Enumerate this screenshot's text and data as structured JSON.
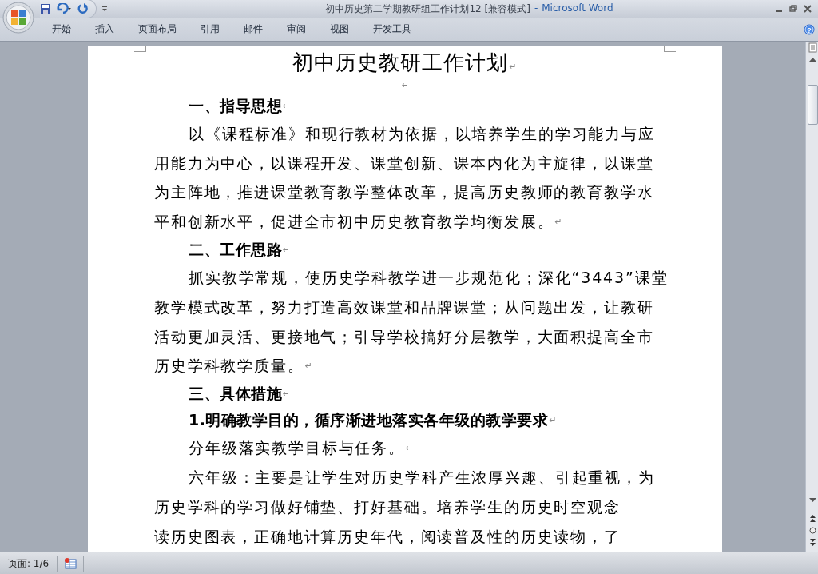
{
  "window": {
    "title": "初中历史第二学期教研组工作计划12 [兼容模式]",
    "separator": "-",
    "app_name": "Microsoft Word"
  },
  "ribbon": {
    "help_label": "?",
    "tabs": [
      {
        "label": "开始",
        "selected": false
      },
      {
        "label": "插入",
        "selected": false
      },
      {
        "label": "页面布局",
        "selected": false
      },
      {
        "label": "引用",
        "selected": false
      },
      {
        "label": "邮件",
        "selected": false
      },
      {
        "label": "审阅",
        "selected": false
      },
      {
        "label": "视图",
        "selected": false
      },
      {
        "label": "开发工具",
        "selected": false
      }
    ]
  },
  "document": {
    "title": "初中历史教研工作计划",
    "paragraph_mark": "↵",
    "paragraphs": [
      {
        "kind": "blank"
      },
      {
        "kind": "heading",
        "lines": [
          "一、指导思想"
        ],
        "mark": true
      },
      {
        "kind": "body",
        "lines": [
          "以《课程标准》和现行教材为依据，以培养学生的学习能力与应",
          "用能力为中心，以课程开发、课堂创新、课本内化为主旋律，以课堂",
          "为主阵地，推进课堂教育教学整体改革，提高历史教师的教育教学水",
          "平和创新水平，促进全市初中历史教育教学均衡发展。"
        ],
        "mark": true
      },
      {
        "kind": "heading",
        "lines": [
          "二、工作思路"
        ],
        "mark": true
      },
      {
        "kind": "body",
        "lines": [
          "抓实教学常规，使历史学科教学进一步规范化；深化“3443”课堂",
          "教学模式改革，努力打造高效课堂和品牌课堂；从问题出发，让教研",
          "活动更加灵活、更接地气；引导学校搞好分层教学，大面积提高全市",
          "历史学科教学质量。"
        ],
        "mark": true
      },
      {
        "kind": "heading",
        "lines": [
          "三、具体措施"
        ],
        "mark": true
      },
      {
        "kind": "subheading",
        "lines": [
          "1.明确教学目的，循序渐进地落实各年级的教学要求"
        ],
        "mark": true
      },
      {
        "kind": "body",
        "lines": [
          "分年级落实教学目标与任务。"
        ],
        "mark": true
      },
      {
        "kind": "body",
        "lines": [
          "六年级：主要是让学生对历史学科产生浓厚兴趣、引起重视，为",
          "历史学科的学习做好铺垫、打好基础。培养学生的历史时空观念",
          "读历史图表，正确地计算历史年代，阅读普及性的历史读物，了"
        ],
        "mark": false
      }
    ]
  },
  "status_bar": {
    "page": "页面: 1/6"
  }
}
